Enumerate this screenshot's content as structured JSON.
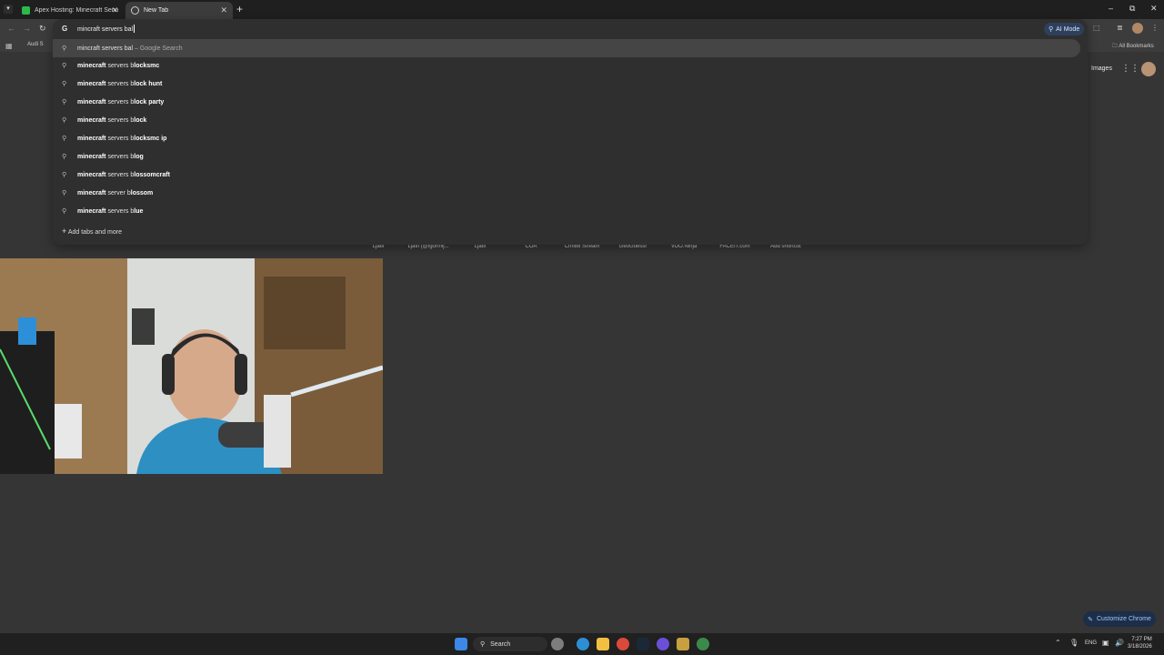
{
  "browser": {
    "tabs": [
      {
        "title": "Apex Hosting: Minecraft Server",
        "active": false
      },
      {
        "title": "New Tab",
        "active": true
      }
    ],
    "new_tab_symbol": "+",
    "window_controls": [
      "–",
      "⧉",
      "✕"
    ],
    "tab_close": "✕"
  },
  "omnibox": {
    "text": "mincraft servers bal",
    "ai_mode_label": "AI Mode",
    "first_suggestion": {
      "query": "mincraft servers bal",
      "suffix": "Google Search",
      "dash": "–"
    },
    "suggestions": [
      {
        "bold_prefix": "minecraft",
        "normal": " servers b",
        "bold_suffix": "locksmc"
      },
      {
        "bold_prefix": "minecraft",
        "normal": " servers b",
        "bold_suffix": "lock hunt"
      },
      {
        "bold_prefix": "minecraft",
        "normal": " servers b",
        "bold_suffix": "lock party"
      },
      {
        "bold_prefix": "minecraft",
        "normal": " servers b",
        "bold_suffix": "lock"
      },
      {
        "bold_prefix": "minecraft",
        "normal": " servers b",
        "bold_suffix": "locksmc ip"
      },
      {
        "bold_prefix": "minecraft",
        "normal": " servers b",
        "bold_suffix": "log"
      },
      {
        "bold_prefix": "minecraft",
        "normal": " servers b",
        "bold_suffix": "lossomcraft"
      },
      {
        "bold_prefix": "minecraft",
        "normal": " server b",
        "bold_suffix": "lossom"
      },
      {
        "bold_prefix": "minecraft",
        "normal": " servers b",
        "bold_suffix": "lue"
      }
    ],
    "add_tabs_label": "Add tabs and more"
  },
  "bookmarks": {
    "items": [
      "Audi S"
    ],
    "all_bookmarks": "All Bookmarks"
  },
  "ntp": {
    "images_link": "Images",
    "shortcuts": [
      "Ljatif",
      "Ljatif (@igormij...",
      "Ljatif",
      "COA",
      "Crni88 Stream",
      "GeoGuessr",
      "VDO.Ninja",
      "FACEIT.com",
      "Add shortcut"
    ],
    "customize_label": "Customize Chrome"
  },
  "taskbar": {
    "search_label": "Search",
    "lang": "ENG",
    "time": "7:27 PM",
    "date": "3/18/2026"
  },
  "colors": {
    "page_bg": "#353535",
    "accent_blue": "#a8c7fa"
  }
}
